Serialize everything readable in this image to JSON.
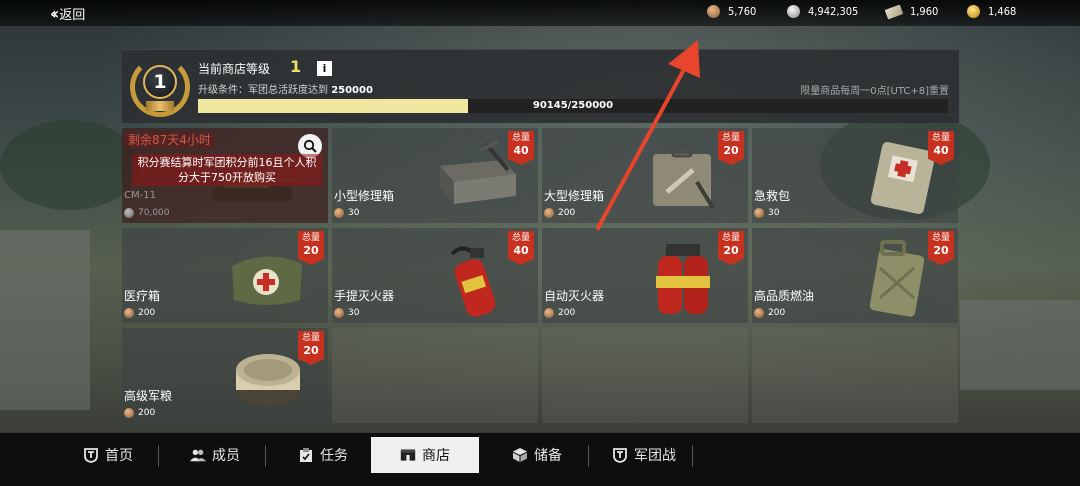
{
  "topbar": {
    "back_label": "返回",
    "currencies": [
      {
        "icon": "bronze-coin-icon",
        "value": "5,760"
      },
      {
        "icon": "silver-coin-icon",
        "value": "4,942,305"
      },
      {
        "icon": "banknote-icon",
        "value": "1,960"
      },
      {
        "icon": "gold-coin-icon",
        "value": "1,468"
      }
    ]
  },
  "level": {
    "title": "当前商店等级",
    "value": "1",
    "medal_number": "1",
    "info_label": "i",
    "condition_label": "升级条件：军团总活跃度达到",
    "condition_value": "250000",
    "progress_text": "90145/250000",
    "progress_fraction": 0.3606,
    "reset_note": "限量商品每周一0点[UTC+8]重置"
  },
  "locked_item": {
    "timer": "剩余87天4小时",
    "message": "积分赛结算时军团积分前16且个人积分大于750开放购买",
    "name": "CM-11",
    "price": "70,000"
  },
  "badge_label": "总量",
  "items": [
    {
      "name": "小型修理箱",
      "price": "30",
      "limit": "40",
      "icon": "toolbox-icon"
    },
    {
      "name": "大型修理箱",
      "price": "200",
      "limit": "20",
      "icon": "suitcase-icon"
    },
    {
      "name": "急救包",
      "price": "30",
      "limit": "40",
      "icon": "first-aid-kit-icon"
    },
    {
      "name": "医疗箱",
      "price": "200",
      "limit": "20",
      "icon": "medical-bag-icon"
    },
    {
      "name": "手提灭火器",
      "price": "30",
      "limit": "40",
      "icon": "fire-extinguisher-icon"
    },
    {
      "name": "自动灭火器",
      "price": "200",
      "limit": "20",
      "icon": "auto-extinguisher-icon"
    },
    {
      "name": "高品质燃油",
      "price": "200",
      "limit": "20",
      "icon": "jerrycan-icon"
    },
    {
      "name": "高级军粮",
      "price": "200",
      "limit": "20",
      "icon": "ration-can-icon"
    }
  ],
  "nav": [
    {
      "label": "首页",
      "icon": "home-shield-icon",
      "active": false
    },
    {
      "label": "成员",
      "icon": "members-icon",
      "active": false
    },
    {
      "label": "任务",
      "icon": "clipboard-icon",
      "active": false
    },
    {
      "label": "商店",
      "icon": "shop-icon",
      "active": true
    },
    {
      "label": "储备",
      "icon": "box-icon",
      "active": false
    },
    {
      "label": "军团战",
      "icon": "legion-shield-icon",
      "active": false
    }
  ],
  "colors": {
    "badge": "#c6321f",
    "level_value": "#f1e061",
    "progress_fill": "#f0e7a0",
    "timer_text": "#cf5a49",
    "annotation_arrow": "#e8452c"
  }
}
